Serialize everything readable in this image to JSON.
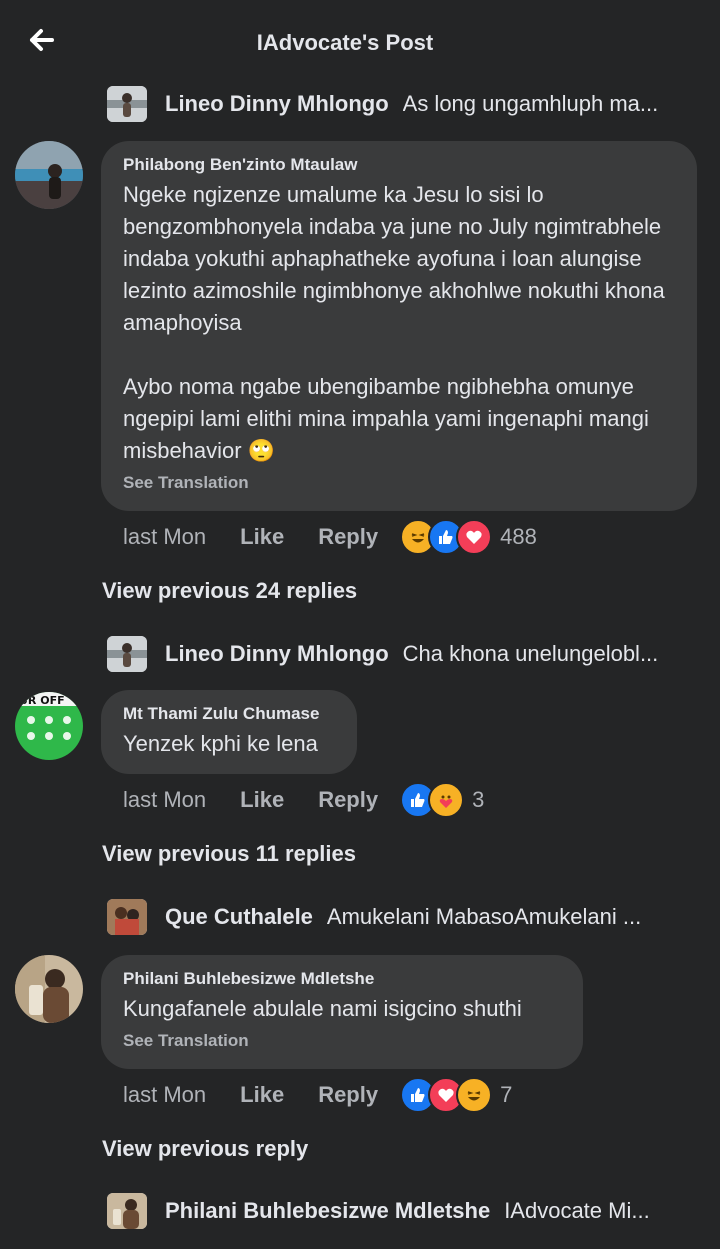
{
  "header": {
    "title": "IAdvocate's Post"
  },
  "thread": [
    {
      "reply_name": "Lineo Dinny Mhlongo",
      "reply_text": "As long ungamhluph ma..."
    },
    {
      "author": "Philabong Ben'zinto Mtaulaw",
      "text": "Ngeke ngizenze umalume ka Jesu lo sisi lo bengzombhonyela indaba ya june no July ngimtrabhele indaba yokuthi aphaphatheke ayofuna i loan alungise lezinto azimoshile ngimbhonye akhohlwe nokuthi khona amaphoyisa\n\nAybo noma ngabe ubengibambe ngibhebha omunye ngepipi lami elithi mina impahla yami ingenaphi mangi misbehavior 🙄",
      "see_translation": "See Translation",
      "time": "last Mon",
      "like": "Like",
      "reply": "Reply",
      "reaction_count": "488"
    },
    {
      "view_previous": "View previous 24 replies"
    },
    {
      "reply_name": "Lineo Dinny Mhlongo",
      "reply_text": "Cha khona unelungelobl..."
    },
    {
      "author": "Mt Thami Zulu Chumase",
      "text": "Yenzek kphi ke lena",
      "time": "last Mon",
      "like": "Like",
      "reply": "Reply",
      "reaction_count": "3",
      "avatar_text": "UR OFF"
    },
    {
      "view_previous": "View previous 11 replies"
    },
    {
      "reply_name": "Que Cuthalele",
      "reply_text": "Amukelani MabasoAmukelani ..."
    },
    {
      "author": "Philani Buhlebesizwe Mdletshe",
      "text": "Kungafanele abulale nami isigcino shuthi",
      "see_translation": "See Translation",
      "time": "last Mon",
      "like": "Like",
      "reply": "Reply",
      "reaction_count": "7"
    },
    {
      "view_previous": "View previous reply"
    },
    {
      "reply_name": "Philani Buhlebesizwe Mdletshe",
      "reply_text": "IAdvocate Mi..."
    }
  ],
  "colors": {
    "background": "#242526",
    "bubble": "#3a3b3c",
    "like_blue": "#1877f2",
    "love_red": "#f33e58",
    "haha_yellow": "#f7b125"
  }
}
